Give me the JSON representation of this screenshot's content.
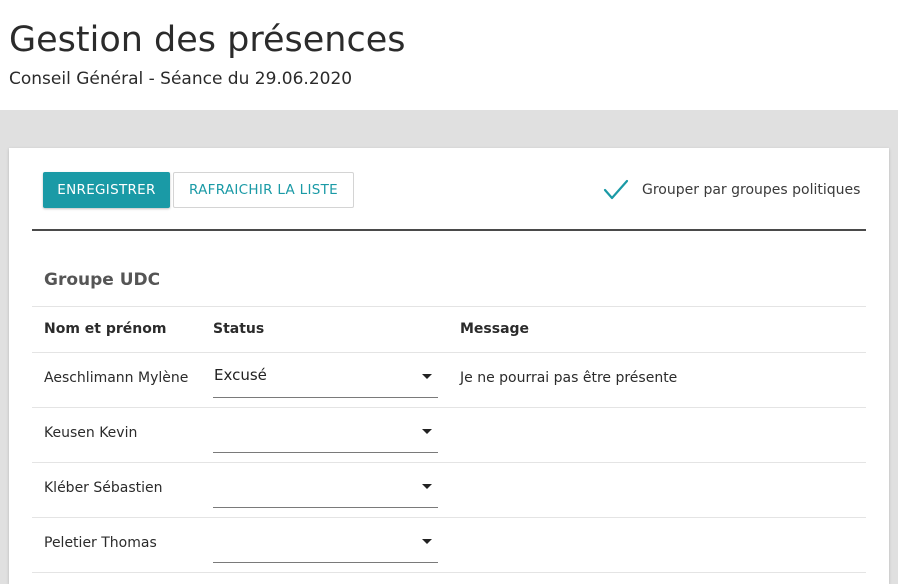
{
  "header": {
    "title": "Gestion des présences",
    "subtitle": "Conseil Général - Séance du 29.06.2020"
  },
  "toolbar": {
    "save_label": "ENREGISTRER",
    "refresh_label": "RAFRAICHIR LA LISTE",
    "group_toggle_label": "Grouper par groupes politiques",
    "group_toggle_checked": true
  },
  "colors": {
    "accent": "#1a9aa6",
    "page_background": "#e0e0e0"
  },
  "group": {
    "name": "Groupe UDC",
    "columns": {
      "name": "Nom et prénom",
      "status": "Status",
      "message": "Message"
    },
    "rows": [
      {
        "name": "Aeschlimann Mylène",
        "status": "Excusé",
        "message": "Je ne pourrai pas être présente"
      },
      {
        "name": "Keusen Kevin",
        "status": "",
        "message": ""
      },
      {
        "name": "Kléber Sébastien",
        "status": "",
        "message": ""
      },
      {
        "name": "Peletier Thomas",
        "status": "",
        "message": ""
      }
    ]
  }
}
